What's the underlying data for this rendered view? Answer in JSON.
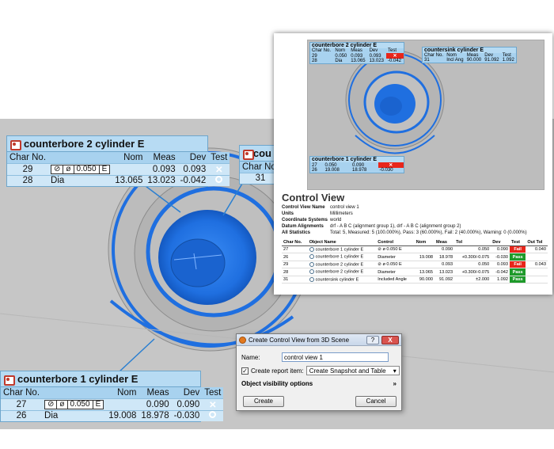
{
  "label_top": {
    "title": "counterbore 2 cylinder E",
    "headers": [
      "Char No.",
      "Nom",
      "Meas",
      "Dev",
      "Test"
    ],
    "rows": [
      {
        "char": "29",
        "fcf": [
          "⊘",
          "ø",
          "0.050",
          "E"
        ],
        "nom": "",
        "meas": "0.093",
        "dev": "0.093",
        "test": "fail"
      },
      {
        "char": "28",
        "name": "Dia",
        "nom": "13.065",
        "meas": "13.023",
        "dev": "-0.042",
        "test": "pass"
      }
    ]
  },
  "label_right": {
    "title": "cou",
    "headers": [
      "Char No."
    ],
    "rows": [
      {
        "char": "31"
      }
    ]
  },
  "label_bottom": {
    "title": "counterbore 1 cylinder E",
    "headers": [
      "Char No.",
      "Nom",
      "Meas",
      "Dev",
      "Test"
    ],
    "rows": [
      {
        "char": "27",
        "fcf": [
          "⊘",
          "ø",
          "0.050",
          "E"
        ],
        "nom": "",
        "meas": "0.090",
        "dev": "0.090",
        "test": "fail"
      },
      {
        "char": "26",
        "name": "Dia",
        "nom": "19.008",
        "meas": "18.978",
        "dev": "-0.030",
        "test": "pass"
      }
    ]
  },
  "report": {
    "mini_top": {
      "title": "counterbore 2 cylinder E",
      "r1": [
        "29",
        "0.050",
        "0.093",
        "0.093"
      ],
      "r2": [
        "28",
        "Dia",
        "13.065",
        "13.023",
        "-0.042"
      ]
    },
    "mini_right": {
      "title": "countersink cylinder E",
      "r1": [
        "31",
        "Incl Ang",
        "90.000",
        "91.092",
        "1.092"
      ]
    },
    "mini_bottom": {
      "title": "counterbore 1 cylinder E",
      "r1": [
        "27",
        "0.050",
        "0.090"
      ],
      "r2": [
        "26",
        "19.008",
        "18.978",
        "-0.030"
      ]
    },
    "mini_headers": [
      "Char No.",
      "Nom",
      "Meas",
      "Dev",
      "Test"
    ],
    "title": "Control View",
    "meta": [
      {
        "k": "Control View Name",
        "v": "control view 1"
      },
      {
        "k": "Units",
        "v": "Millimeters"
      },
      {
        "k": "Coordinate Systems",
        "v": "world"
      },
      {
        "k": "Datum Alignments",
        "v": "drf - A B C (alignment group 1), drf - A B C (alignment group 2)"
      },
      {
        "k": "All Statistics",
        "v": "Total: 5, Measured: 5 (100.000%), Pass: 3 (60.000%), Fail: 2 (40.000%), Warning: 0 (0.000%)"
      }
    ],
    "columns": [
      "Char No.",
      "Object Name",
      "Control",
      "Nom",
      "Meas",
      "Tol",
      "Dev",
      "Test",
      "Out Tol"
    ],
    "rows": [
      {
        "char": "27",
        "obj": "counterbore 1 cylinder E",
        "ctrl": "⊘ ø 0.050 E",
        "nom": "",
        "meas": "0.090",
        "tol": "0.050",
        "dev": "0.090",
        "test": "Fail",
        "out": "0.040"
      },
      {
        "char": "26",
        "obj": "counterbore 1 cylinder E",
        "ctrl": "Diameter",
        "nom": "19.008",
        "meas": "18.978",
        "tol": "+0.300/-0.075",
        "dev": "-0.030",
        "test": "Pass",
        "out": ""
      },
      {
        "char": "29",
        "obj": "counterbore 2 cylinder E",
        "ctrl": "⊘ ø 0.050 E",
        "nom": "",
        "meas": "0.093",
        "tol": "0.050",
        "dev": "0.093",
        "test": "Fail",
        "out": "0.043"
      },
      {
        "char": "28",
        "obj": "counterbore 2 cylinder E",
        "ctrl": "Diameter",
        "nom": "13.065",
        "meas": "13.023",
        "tol": "+0.300/-0.075",
        "dev": "-0.042",
        "test": "Pass",
        "out": ""
      },
      {
        "char": "31",
        "obj": "countersink cylinder E",
        "ctrl": "Included Angle",
        "nom": "90.000",
        "meas": "91.092",
        "tol": "±2.000",
        "dev": "1.092",
        "test": "Pass",
        "out": ""
      }
    ]
  },
  "dialog": {
    "title": "Create Control View from 3D Scene",
    "help": "?",
    "close": "X",
    "name_label": "Name:",
    "name_value": "control view 1",
    "create_report_label": "Create report item:",
    "report_option": "Create Snapshot and Table",
    "visibility_label": "Object visibility options",
    "create_btn": "Create",
    "cancel_btn": "Cancel"
  },
  "colors": {
    "fail": "#e8261b",
    "pass": "#1e9a2a",
    "label_bg": "#a8d2ef",
    "feature_blue": "#1f6fe0"
  }
}
